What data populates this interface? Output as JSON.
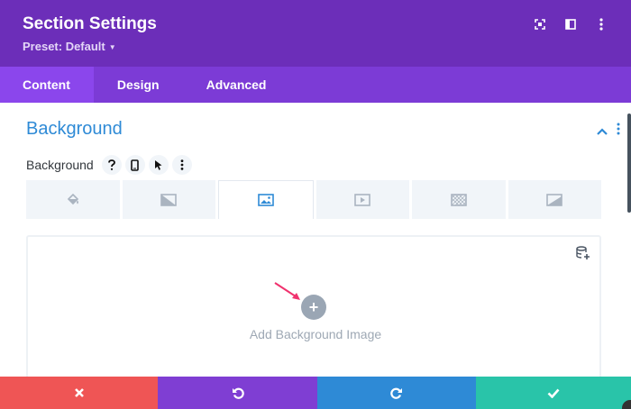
{
  "header": {
    "title": "Section Settings",
    "preset": "Preset: Default",
    "icons": [
      "fullscreen-icon",
      "sidebar-layout-icon",
      "more-vertical-icon"
    ],
    "bg_color": "#6c2eb9"
  },
  "tabs": [
    {
      "label": "Content",
      "active": true
    },
    {
      "label": "Design",
      "active": false
    },
    {
      "label": "Advanced",
      "active": false
    }
  ],
  "group": {
    "title": "Background",
    "title_color": "#2e8ad6",
    "field_label": "Background",
    "field_icons": [
      "help-icon",
      "mobile-icon",
      "cursor-hover-icon",
      "more-vertical-icon"
    ]
  },
  "background_types": [
    {
      "name": "color-fill-icon",
      "active": false
    },
    {
      "name": "gradient-icon",
      "active": false
    },
    {
      "name": "image-icon",
      "active": true
    },
    {
      "name": "video-icon",
      "active": false
    },
    {
      "name": "pattern-icon",
      "active": false
    },
    {
      "name": "mask-icon",
      "active": false
    }
  ],
  "upload": {
    "add_label": "Add Background Image",
    "plus": "+"
  },
  "footer": {
    "buttons": [
      {
        "name": "cancel-icon",
        "color": "#ef5555"
      },
      {
        "name": "undo-icon",
        "color": "#7f3ed3"
      },
      {
        "name": "redo-icon",
        "color": "#2e8ad6"
      },
      {
        "name": "save-check-icon",
        "color": "#29c4a9"
      }
    ]
  }
}
